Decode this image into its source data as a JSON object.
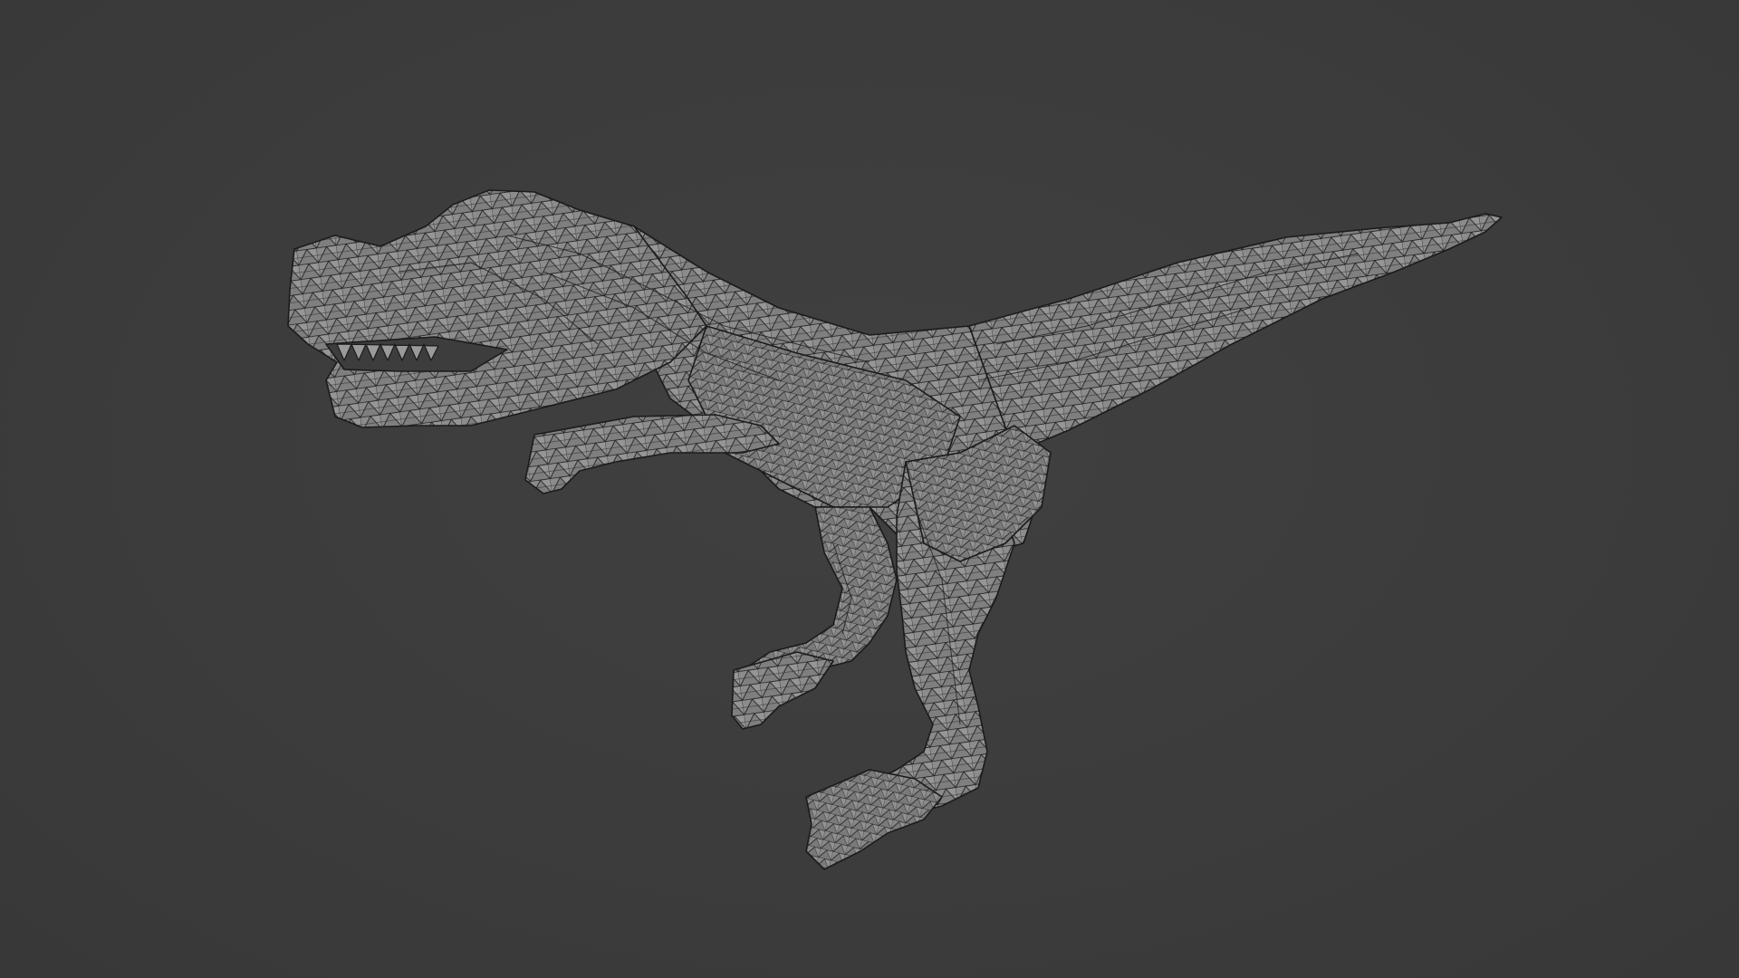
{
  "viewport": {
    "background_color": "#3d3d3d",
    "mode": "3d-viewport"
  },
  "model": {
    "subject": "dinosaur-mesh",
    "display": "wireframe-over-solid",
    "mesh_fill_color": "#8a8a8a",
    "wire_color": "#1c1c1c"
  }
}
